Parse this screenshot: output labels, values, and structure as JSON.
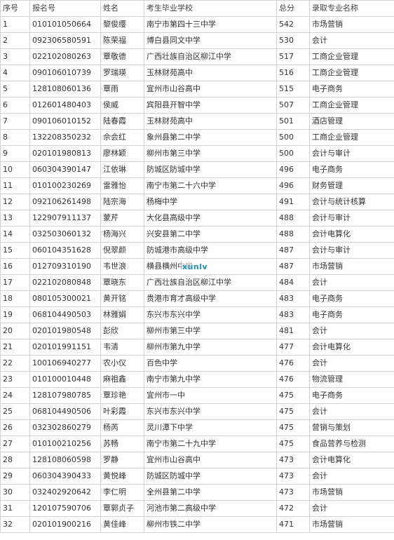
{
  "table": {
    "headers": {
      "seq": "序号",
      "id": "报名号",
      "name": "姓名",
      "school": "考生毕业学校",
      "score": "总分",
      "major": "录取专业名称"
    },
    "rows": [
      {
        "seq": "1",
        "id": "010101050664",
        "name": "黎俊缨",
        "school": "南宁市第四十三中学",
        "score": "542",
        "major": "市场营销"
      },
      {
        "seq": "2",
        "id": "092306580591",
        "name": "陈荣福",
        "school": "博白县同文中学",
        "score": "530",
        "major": "会计"
      },
      {
        "seq": "3",
        "id": "022102080263",
        "name": "覃敬德",
        "school": "广西壮族自治区柳江中学",
        "score": "517",
        "major": "工商企业管理"
      },
      {
        "seq": "4",
        "id": "090106010739",
        "name": "罗瑞瑛",
        "school": "玉林财苑高中",
        "score": "516",
        "major": "工商企业管理"
      },
      {
        "seq": "5",
        "id": "128108060136",
        "name": "覃雨",
        "school": "宜州市山谷高中",
        "score": "515",
        "major": "电子商务"
      },
      {
        "seq": "6",
        "id": "012601480403",
        "name": "侯威",
        "school": "宾阳县开智中学",
        "score": "507",
        "major": "工商企业管理"
      },
      {
        "seq": "7",
        "id": "090106010152",
        "name": "陆春霞",
        "school": "玉林财苑高中",
        "score": "501",
        "major": "酒店管理"
      },
      {
        "seq": "8",
        "id": "132208350232",
        "name": "佘会红",
        "school": "象州县第二中学",
        "score": "500",
        "major": "工商企业管理"
      },
      {
        "seq": "9",
        "id": "020101980813",
        "name": "廖林颖",
        "school": "柳州市第三中学",
        "score": "500",
        "major": "会计与审计"
      },
      {
        "seq": "10",
        "id": "060304390147",
        "name": "江依琳",
        "school": "防城区防城中学",
        "score": "496",
        "major": "电子商务"
      },
      {
        "seq": "11",
        "id": "010100230269",
        "name": "雷雅怡",
        "school": "南宁市第二十六中学",
        "score": "496",
        "major": "财务管理"
      },
      {
        "seq": "12",
        "id": "092106261498",
        "name": "陆宗海",
        "school": "杨梅中学",
        "score": "491",
        "major": "会计与统计核算"
      },
      {
        "seq": "13",
        "id": "122907911137",
        "name": "蒙芹",
        "school": "大化县高级中学",
        "score": "488",
        "major": "会计与审计"
      },
      {
        "seq": "14",
        "id": "032503060132",
        "name": "杨海兴",
        "school": "兴安县第二中学",
        "score": "488",
        "major": "会计电算化"
      },
      {
        "seq": "15",
        "id": "060104351628",
        "name": "倪翠颜",
        "school": "防城港市高级中学",
        "score": "487",
        "major": "会计与审计"
      },
      {
        "seq": "16",
        "id": "012709310190",
        "name": "韦世浪",
        "school": "横县横州中学",
        "score": "487",
        "major": "市场营销"
      },
      {
        "seq": "17",
        "id": "022102080848",
        "name": "覃晓东",
        "school": "广西壮族自治区柳江中学",
        "score": "484",
        "major": "会计"
      },
      {
        "seq": "18",
        "id": "080105300021",
        "name": "黄开铭",
        "school": "贵港市育才高级中学",
        "score": "483",
        "major": "电子商务"
      },
      {
        "seq": "19",
        "id": "068104490503",
        "name": "林雅娟",
        "school": "东兴市东兴中学",
        "score": "483",
        "major": "电子商务"
      },
      {
        "seq": "20",
        "id": "020101980548",
        "name": "彭欣",
        "school": "柳州市第三中学",
        "score": "481",
        "major": "会计"
      },
      {
        "seq": "21",
        "id": "020101991151",
        "name": "韦清",
        "school": "柳州市第九中学",
        "score": "477",
        "major": "会计电算化"
      },
      {
        "seq": "22",
        "id": "100106940277",
        "name": "农小仪",
        "school": "百色中学",
        "score": "476",
        "major": "会计"
      },
      {
        "seq": "23",
        "id": "010100010448",
        "name": "麻祖鑫",
        "school": "南宁市第九中学",
        "score": "476",
        "major": "物流管理"
      },
      {
        "seq": "24",
        "id": "128107980785",
        "name": "覃珍艳",
        "school": "宜州市一中",
        "score": "475",
        "major": "电子商务"
      },
      {
        "seq": "25",
        "id": "068104490506",
        "name": "叶彩霞",
        "school": "东兴市东兴中学",
        "score": "475",
        "major": "会计"
      },
      {
        "seq": "26",
        "id": "032302860279",
        "name": "杨芮",
        "school": "灵川潭下中学",
        "score": "475",
        "major": "营销与策划"
      },
      {
        "seq": "27",
        "id": "010100210256",
        "name": "苏畅",
        "school": "南宁市第二十九中学",
        "score": "475",
        "major": "食品营养与检测"
      },
      {
        "seq": "28",
        "id": "128108060598",
        "name": "罗静",
        "school": "宜州市山谷高中",
        "score": "473",
        "major": "会计电算化"
      },
      {
        "seq": "29",
        "id": "060304390433",
        "name": "黄悦峰",
        "school": "防城区防城中学",
        "score": "473",
        "major": "会计"
      },
      {
        "seq": "30",
        "id": "032402920642",
        "name": "李仁明",
        "school": "全州县第二中学",
        "score": "473",
        "major": "市场营销"
      },
      {
        "seq": "31",
        "id": "120107590706",
        "name": "覃郭贞子",
        "school": "河池市第二高级中学",
        "score": "472",
        "major": "会计"
      },
      {
        "seq": "32",
        "id": "020101900216",
        "name": "黄佳峰",
        "school": "柳州市铁二中学",
        "score": "471",
        "major": "市场营销"
      }
    ]
  },
  "watermark": {
    "text": "xunlv",
    "color": "#1f8fb8"
  }
}
